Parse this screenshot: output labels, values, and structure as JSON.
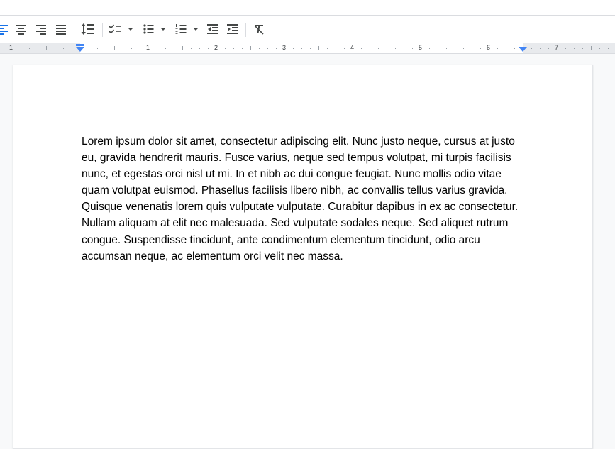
{
  "toolbar": {
    "icons": [
      "align-left-icon",
      "align-center-icon",
      "align-right-icon",
      "align-justify-icon",
      "line-spacing-icon",
      "checklist-icon",
      "bulleted-list-icon",
      "numbered-list-icon",
      "decrease-indent-icon",
      "increase-indent-icon",
      "clear-formatting-icon"
    ],
    "active_color": "#1a73e8"
  },
  "ruler": {
    "numbers": [
      "1",
      "1",
      "2",
      "3",
      "4",
      "5",
      "6",
      "7"
    ],
    "indent_marker_color": "#4285f4"
  },
  "document": {
    "body": "Lorem ipsum dolor sit amet, consectetur adipiscing elit. Nunc justo neque, cursus at justo eu, gravida hendrerit mauris. Fusce varius, neque sed tempus volutpat, mi turpis facilisis nunc, et egestas orci nisl ut mi. In et nibh ac dui congue feugiat. Nunc mollis odio vitae quam volutpat euismod. Phasellus facilisis libero nibh, ac convallis tellus varius gravida. Quisque venenatis lorem quis vulputate vulputate. Curabitur dapibus in ex ac consectetur. Nullam aliquam at elit nec malesuada. Sed vulputate sodales neque. Sed aliquet rutrum congue. Suspendisse tincidunt, ante condimentum elementum tincidunt, odio arcu accumsan neque, ac elementum orci velit nec massa."
  }
}
